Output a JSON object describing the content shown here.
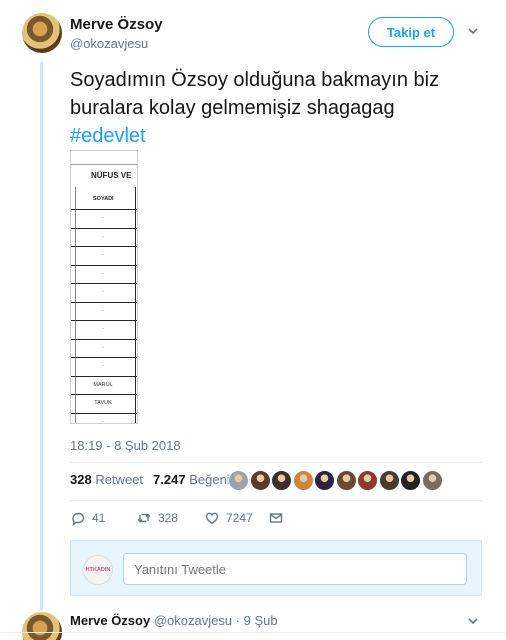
{
  "tweet": {
    "author_name": "Merve Özsoy",
    "author_handle": "@okozavjesu",
    "follow_label": "Takip et",
    "text": "Soyadımın Özsoy olduğuna bakmayın biz buralara kolay gelmemişiz shagagag",
    "hashtag": "#edevlet",
    "timestamp": "18:19 - 8 Şub 2018"
  },
  "media": {
    "title": "NÜFUS VE",
    "column_header": "SOYADI",
    "rows": [
      "·",
      "·",
      "·",
      "·",
      "·",
      "·",
      "·",
      "·",
      "·",
      "MARUL",
      "TAVUK",
      "·"
    ]
  },
  "stats": {
    "retweet_count": "328",
    "retweet_label": "Retweet",
    "like_count": "7.247",
    "like_label": "Beğeni"
  },
  "likers": {
    "colors": [
      "#9aa4ad",
      "#5a3b2e",
      "#3d2f2a",
      "#c7873f",
      "#2d2440",
      "#6b4a33",
      "#8a3b2a",
      "#4a3a2e",
      "#222222",
      "#7d6a5c"
    ]
  },
  "actions": {
    "reply_count": "41",
    "retweet_count": "328",
    "like_count": "7247"
  },
  "reply": {
    "avatar_text": "HTKADIN",
    "placeholder": "Yanıtını Tweetle"
  },
  "next_tweet": {
    "author_name": "Merve Özsoy",
    "meta": "@okozavjesu · 9 Şub"
  },
  "colors": {
    "accent": "#1da1f2",
    "muted": "#657786",
    "thread_line": "#cde7f7"
  }
}
